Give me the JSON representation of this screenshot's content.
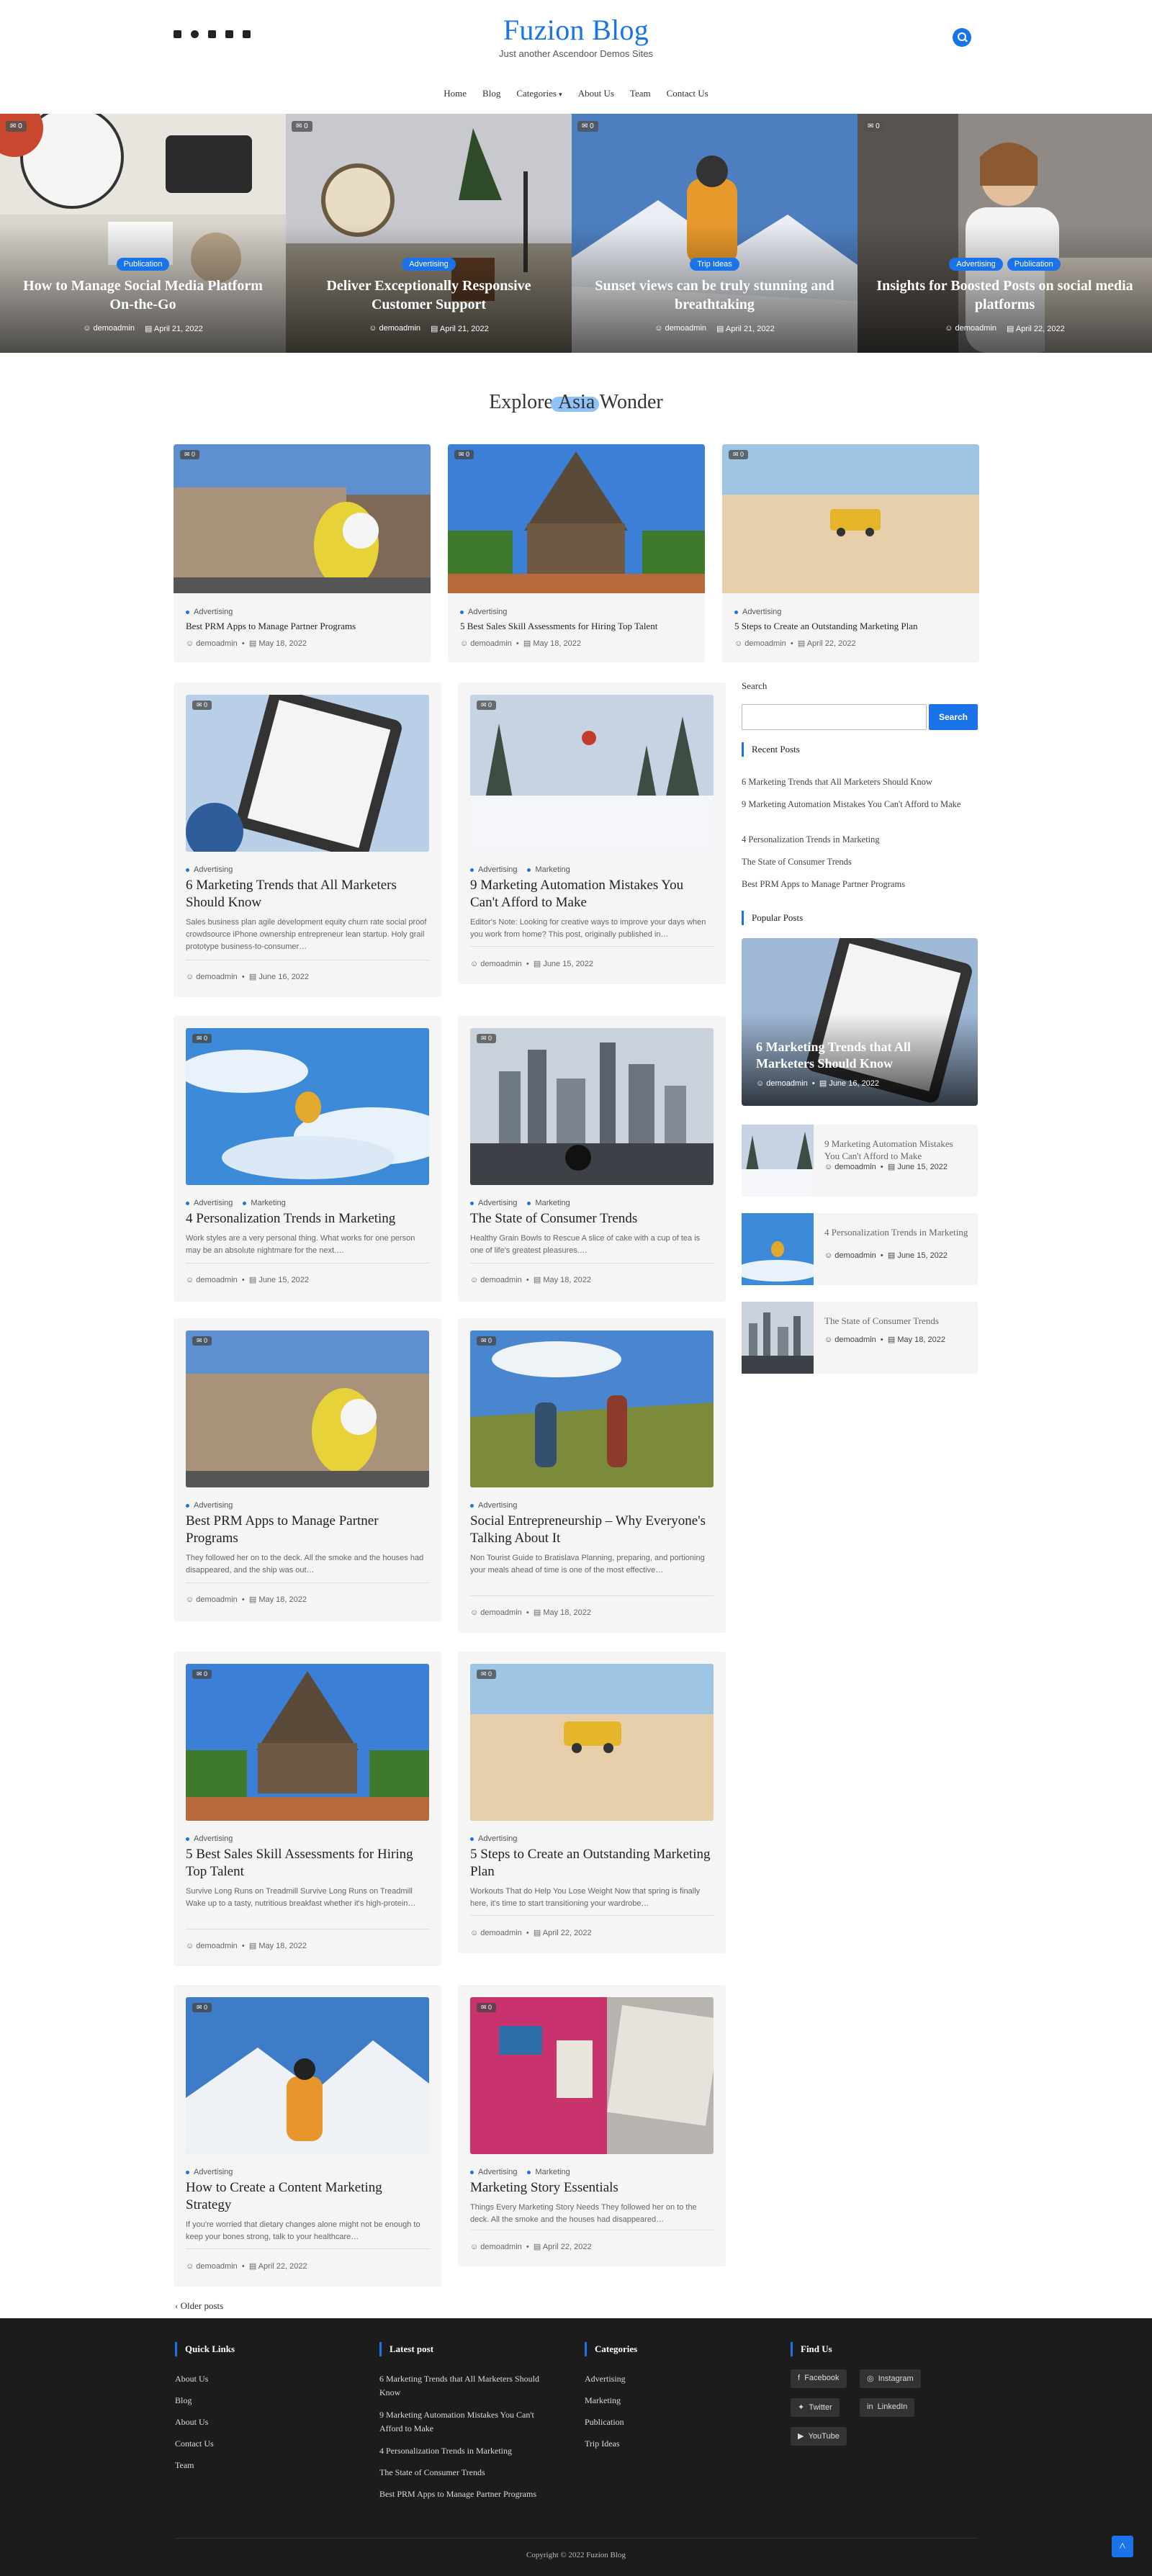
{
  "site": {
    "title": "Fuzion Blog",
    "tagline": "Just another Ascendoor Demos Sites"
  },
  "nav": [
    "Home",
    "Blog",
    "Categories",
    "About Us",
    "Team",
    "Contact Us"
  ],
  "hero": [
    {
      "cats": [
        "Publication"
      ],
      "title": "How to Manage Social Media Platform On-the-Go",
      "author": "demoadmin",
      "date": "April 21, 2022",
      "comments": "0"
    },
    {
      "cats": [
        "Advertising"
      ],
      "title": "Deliver Exceptionally Responsive Customer Support",
      "author": "demoadmin",
      "date": "April 21, 2022",
      "comments": "0"
    },
    {
      "cats": [
        "Trip Ideas"
      ],
      "title": "Sunset views can be truly stunning and breathtaking",
      "author": "demoadmin",
      "date": "April 21, 2022",
      "comments": "0"
    },
    {
      "cats": [
        "Advertising",
        "Publication"
      ],
      "title": "Insights for Boosted Posts on social media platforms",
      "author": "demoadmin",
      "date": "April 22, 2022",
      "comments": "0"
    }
  ],
  "explore": {
    "pre": "Explore ",
    "highlight": "Asia",
    "post": " Wonder"
  },
  "featured": [
    {
      "cat": "Advertising",
      "title": "Best PRM Apps to Manage Partner Programs",
      "author": "demoadmin",
      "date": "May 18, 2022",
      "comments": "0"
    },
    {
      "cat": "Advertising",
      "title": "5 Best Sales Skill Assessments for Hiring Top Talent",
      "author": "demoadmin",
      "date": "May 18, 2022",
      "comments": "0"
    },
    {
      "cat": "Advertising",
      "title": "5 Steps to Create an Outstanding Marketing Plan",
      "author": "demoadmin",
      "date": "April 22, 2022",
      "comments": "0"
    }
  ],
  "posts": [
    {
      "cats": [
        "Advertising"
      ],
      "title": "6 Marketing Trends that All Marketers Should Know",
      "excerpt": "Sales business plan agile development equity churn rate social proof crowdsource iPhone ownership entrepreneur lean startup. Holy grail prototype business-to-consumer…",
      "author": "demoadmin",
      "date": "June 16, 2022",
      "comments": "0"
    },
    {
      "cats": [
        "Advertising",
        "Marketing"
      ],
      "title": "9 Marketing Automation Mistakes You Can't Afford to Make",
      "excerpt": "Editor's Note: Looking for creative ways to improve your days when you work from home? This post, originally published in…",
      "author": "demoadmin",
      "date": "June 15, 2022",
      "comments": "0"
    },
    {
      "cats": [
        "Advertising",
        "Marketing"
      ],
      "title": "4 Personalization Trends in Marketing",
      "excerpt": "Work styles are a very personal thing. What works for one person may be an absolute nightmare for the next.…",
      "author": "demoadmin",
      "date": "June 15, 2022",
      "comments": "0"
    },
    {
      "cats": [
        "Advertising",
        "Marketing"
      ],
      "title": "The State of Consumer Trends",
      "excerpt": "Healthy Grain Bowls to Rescue A slice of cake with a cup of tea is one of life's greatest pleasures.…",
      "author": "demoadmin",
      "date": "May 18, 2022",
      "comments": "0"
    },
    {
      "cats": [
        "Advertising"
      ],
      "title": "Best PRM Apps to Manage Partner Programs",
      "excerpt": "They followed her on to the deck. All the smoke and the houses had disappeared, and the ship was out…",
      "author": "demoadmin",
      "date": "May 18, 2022",
      "comments": "0"
    },
    {
      "cats": [
        "Advertising"
      ],
      "title": "Social Entrepreneurship – Why Everyone's Talking About It",
      "excerpt": "Non Tourist Guide to Bratislava Planning, preparing, and portioning your meals ahead of time is one of the most effective…",
      "author": "demoadmin",
      "date": "May 18, 2022",
      "comments": "0"
    },
    {
      "cats": [
        "Advertising"
      ],
      "title": "5 Best Sales Skill Assessments for Hiring Top Talent",
      "excerpt": "Survive Long Runs on Treadmill Survive Long Runs on Treadmill Wake up to a tasty, nutritious breakfast whether it's high-protein…",
      "author": "demoadmin",
      "date": "May 18, 2022",
      "comments": "0"
    },
    {
      "cats": [
        "Advertising"
      ],
      "title": "5 Steps to Create an Outstanding Marketing Plan",
      "excerpt": "Workouts That do Help You Lose Weight Now that spring is finally here, it's time to start transitioning your wardrobe…",
      "author": "demoadmin",
      "date": "April 22, 2022",
      "comments": "0"
    },
    {
      "cats": [
        "Advertising"
      ],
      "title": "How to Create a Content Marketing Strategy",
      "excerpt": "If you're worried that dietary changes alone might not be enough to keep your bones strong, talk to your healthcare…",
      "author": "demoadmin",
      "date": "April 22, 2022",
      "comments": "0"
    },
    {
      "cats": [
        "Advertising",
        "Marketing"
      ],
      "title": "Marketing Story Essentials",
      "excerpt": "Things Every Marketing Story Needs They followed her on to the deck. All the smoke and the houses had disappeared…",
      "author": "demoadmin",
      "date": "April 22, 2022",
      "comments": "0"
    }
  ],
  "sidebar": {
    "search_label": "Search",
    "search_button": "Search",
    "recent_title": "Recent Posts",
    "recent": [
      "6 Marketing Trends that All Marketers Should Know",
      "9 Marketing Automation Mistakes You Can't Afford to Make",
      "4 Personalization Trends in Marketing",
      "The State of Consumer Trends",
      "Best PRM Apps to Manage Partner Programs"
    ],
    "popular_title": "Popular Posts",
    "popular_main": {
      "title": "6 Marketing Trends that All Marketers Should Know",
      "author": "demoadmin",
      "date": "June 16, 2022"
    },
    "popular": [
      {
        "title": "9 Marketing Automation Mistakes You Can't Afford to Make",
        "author": "demoadmin",
        "date": "June 15, 2022"
      },
      {
        "title": "4 Personalization Trends in Marketing",
        "author": "demoadmin",
        "date": "June 15, 2022"
      },
      {
        "title": "The State of Consumer Trends",
        "author": "demoadmin",
        "date": "May 18, 2022"
      }
    ]
  },
  "older_posts": "Older posts",
  "footer": {
    "quick_title": "Quick Links",
    "quick": [
      "About Us",
      "Blog",
      "About Us",
      "Contact Us",
      "Team"
    ],
    "latest_title": "Latest post",
    "latest": [
      "6 Marketing Trends that All Marketers Should Know",
      "9 Marketing Automation Mistakes You Can't Afford to Make",
      "4 Personalization Trends in Marketing",
      "The State of Consumer Trends",
      "Best PRM Apps to Manage Partner Programs"
    ],
    "cat_title": "Categories",
    "cats": [
      "Advertising",
      "Marketing",
      "Publication",
      "Trip Ideas"
    ],
    "find_title": "Find Us",
    "social": [
      "Facebook",
      "Instagram",
      "Twitter",
      "LinkedIn",
      "YouTube"
    ],
    "copyright": "Copyright © 2022 Fuzion Blog"
  },
  "colors": {
    "accent": "#1a73e8",
    "footer_bg": "#1c1c1c"
  }
}
